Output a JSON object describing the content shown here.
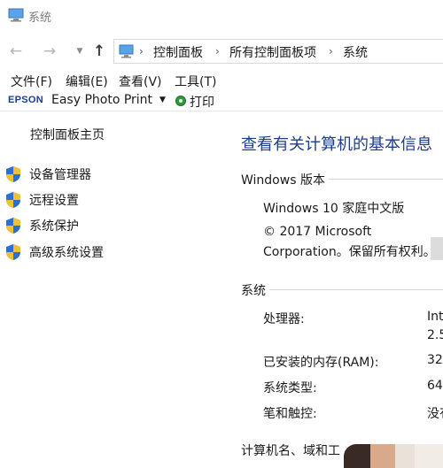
{
  "window": {
    "title": "系统"
  },
  "address": {
    "crumbs": [
      "控制面板",
      "所有控制面板项",
      "系统"
    ]
  },
  "menu": {
    "items": [
      "文件(F)",
      "编辑(E)",
      "查看(V)",
      "工具(T)"
    ]
  },
  "toolbar": {
    "epson": "EPSON",
    "easy_photo_print": "Easy Photo Print",
    "print": "打印"
  },
  "sidebar": {
    "home": "控制面板主页",
    "links": [
      "设备管理器",
      "远程设置",
      "系统保护",
      "高级系统设置"
    ]
  },
  "main": {
    "heading": "查看有关计算机的基本信息",
    "windows_section": {
      "title": "Windows 版本",
      "edition": "Windows 10 家庭中文版",
      "copyright_line1": "© 2017 Microsoft",
      "copyright_line2": "Corporation。保留所有权利。"
    },
    "system_section": {
      "title": "系统",
      "rows": [
        {
          "label": "处理器:",
          "value": "Int",
          "value2": "2.5"
        },
        {
          "label": "已安装的内存(RAM):",
          "value": "32"
        },
        {
          "label": "系统类型:",
          "value": "64"
        },
        {
          "label": "笔和触控:",
          "value": "没有"
        }
      ]
    },
    "computer_section": {
      "title": "计算机名、域和工"
    }
  },
  "colors": {
    "heading_blue": "#1e3d8f",
    "shield_blue": "#2a6fd6",
    "shield_yellow": "#f2c12e"
  }
}
